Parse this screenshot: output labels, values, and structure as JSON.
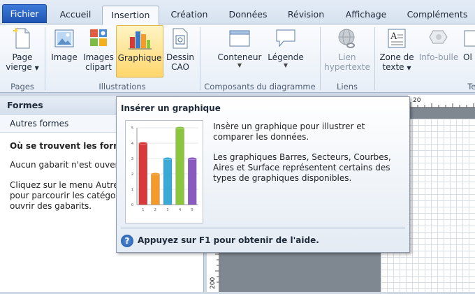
{
  "tabs": [
    "Fichier",
    "Accueil",
    "Insertion",
    "Création",
    "Données",
    "Révision",
    "Affichage",
    "Compléments"
  ],
  "active_tab": "Insertion",
  "ribbon": {
    "groups": {
      "pages": "Pages",
      "illustrations": "Illustrations",
      "diagram_parts": "Composants du diagramme",
      "links": "Liens",
      "text": "Tex"
    },
    "buttons": {
      "page_blank": [
        "Page",
        "vierge"
      ],
      "image": "Image",
      "clipart": [
        "Images",
        "clipart"
      ],
      "chart": "Graphique",
      "cad": [
        "Dessin",
        "CAO"
      ],
      "container": "Conteneur",
      "legend": "Légende",
      "hyperlink": [
        "Lien",
        "hypertexte"
      ],
      "textbox": [
        "Zone de",
        "texte"
      ],
      "screentip": "Info-bulle",
      "object_partial": "Ol"
    }
  },
  "shapes_pane": {
    "title": "Formes",
    "more_shapes": "Autres formes",
    "heading": "Où se trouvent les formes",
    "line1": "Aucun gabarit n'est ouver",
    "line2": [
      "Cliquez sur le menu Autre",
      "pour parcourir les catégo",
      "ouvrir des gabarits."
    ]
  },
  "rulers": {
    "h_label": "20",
    "v_label": "200"
  },
  "tooltip": {
    "title": "Insérer un graphique",
    "desc1": "Insère un graphique pour illustrer et comparer les données.",
    "desc2": "Les graphiques Barres, Secteurs, Courbes, Aires et Surface représentent certains des types de graphiques disponibles.",
    "help": "Appuyez sur F1 pour obtenir de l'aide."
  },
  "chart_data": {
    "type": "bar",
    "categories": [
      "1",
      "2",
      "3",
      "4",
      "5"
    ],
    "values": [
      4,
      2,
      3,
      5,
      3
    ],
    "ylim": [
      0,
      5
    ],
    "yticks": [
      "0",
      "1",
      "2",
      "3",
      "4",
      "5"
    ],
    "colors": [
      "#d9393b",
      "#f39a2b",
      "#3aa9d6",
      "#8cc63f",
      "#8a5bbf"
    ]
  },
  "colors": {
    "file_tab": "#2a63c4",
    "highlight": "#ffd66c"
  }
}
